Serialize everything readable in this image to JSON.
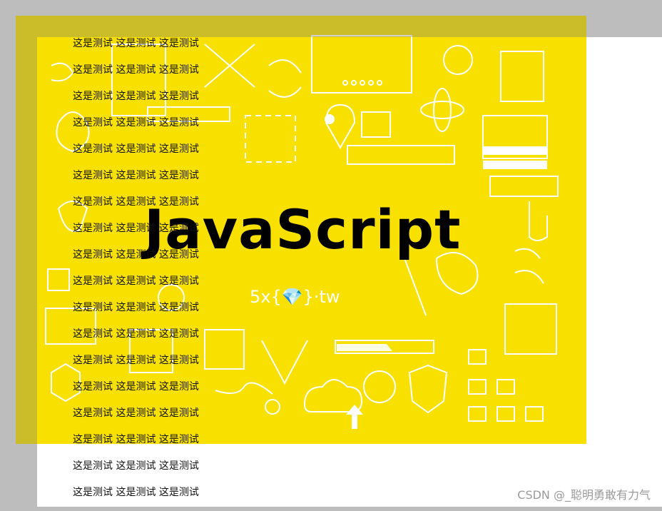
{
  "hero": {
    "title": "JavaScript",
    "brand": "5x{💎}·tw",
    "background_color": "#f8e000",
    "doodle_color": "#ffffff"
  },
  "test_lines": [
    "这是测试 这是测试 这是测试",
    "这是测试 这是测试 这是测试",
    "这是测试 这是测试 这是测试",
    "这是测试 这是测试 这是测试",
    "这是测试 这是测试 这是测试",
    "这是测试 这是测试 这是测试",
    "这是测试 这是测试 这是测试",
    "这是测试 这是测试 这是测试",
    "这是测试 这是测试 这是测试",
    "这是测试 这是测试 这是测试",
    "这是测试 这是测试 这是测试",
    "这是测试 这是测试 这是测试",
    "这是测试 这是测试 这是测试",
    "这是测试 这是测试 这是测试",
    "这是测试 这是测试 这是测试",
    "这是测试 这是测试 这是测试",
    "这是测试 这是测试 这是测试",
    "这是测试 这是测试 这是测试"
  ],
  "watermark": "CSDN @_聪明勇敢有力气"
}
